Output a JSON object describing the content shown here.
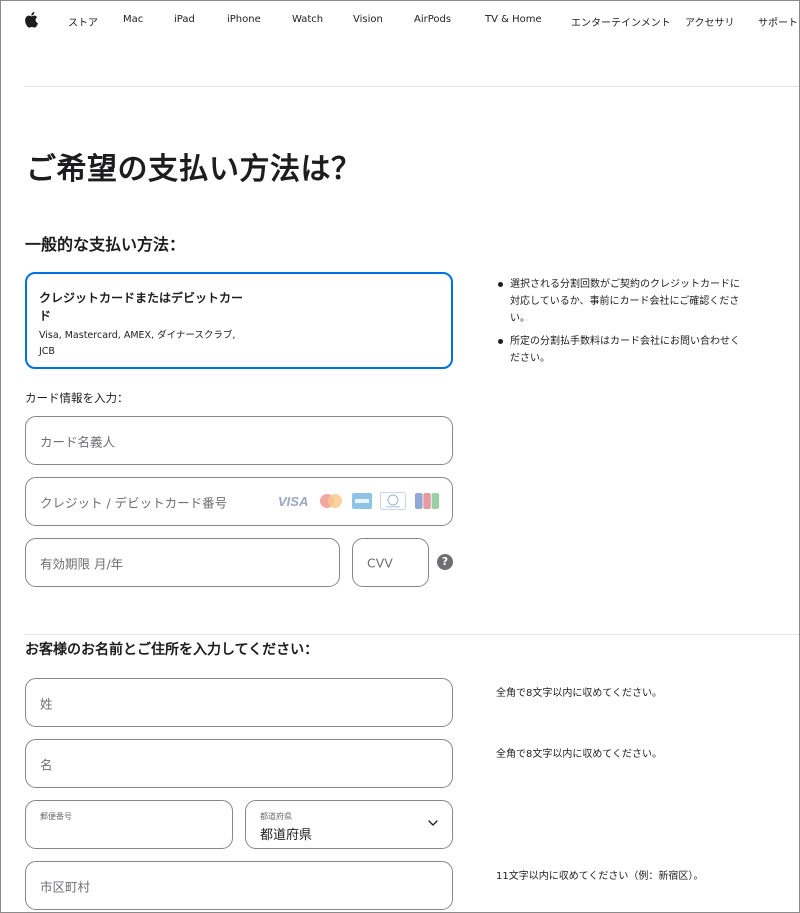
{
  "nav": {
    "logo_icon": "apple-logo-icon",
    "items": [
      "ストア",
      "Mac",
      "iPad",
      "iPhone",
      "Watch",
      "Vision",
      "AirPods",
      "TV & Home",
      "エンターテインメント",
      "アクセサリ",
      "サポート"
    ]
  },
  "page": {
    "title": "ご希望の支払い方法は？"
  },
  "payment": {
    "section_title": "一般的な支払い方法：",
    "option": {
      "title": "クレジットカードまたはデビットカード",
      "subtitle": "Visa, Mastercard, AMEX, ダイナースクラブ, JCB"
    },
    "notes": [
      "選択される分割回数がご契約のクレジットカードに対応しているか、事前にカード会社にご確認ください。",
      "所定の分割払手数料はカード会社にお問い合わせください。"
    ],
    "card_info_label": "カード情報を入力：",
    "cardholder_placeholder": "カード名義人",
    "card_number_placeholder": "クレジット / デビットカード番号",
    "card_brands": [
      "VISA",
      "Mastercard",
      "AMEX",
      "Diners Club",
      "JCB"
    ],
    "expiry_placeholder": "有効期限 月/年",
    "cvv_placeholder": "CVV",
    "help_glyph": "?"
  },
  "address": {
    "section_title": "お客様のお名前とご住所を入力してください：",
    "last_name_placeholder": "姓",
    "last_name_hint": "全角で8文字以内に収めてください。",
    "first_name_placeholder": "名",
    "first_name_hint": "全角で8文字以内に収めてください。",
    "postal_label": "郵便番号",
    "prefecture_label": "都道府県",
    "prefecture_value": "都道府県",
    "city_placeholder": "市区町村",
    "city_hint": "11文字以内に収めてください（例：新宿区）。"
  },
  "colors": {
    "accent": "#0071e3",
    "text": "#1d1d1f",
    "border": "#86868b",
    "placeholder": "#6e6e73"
  }
}
